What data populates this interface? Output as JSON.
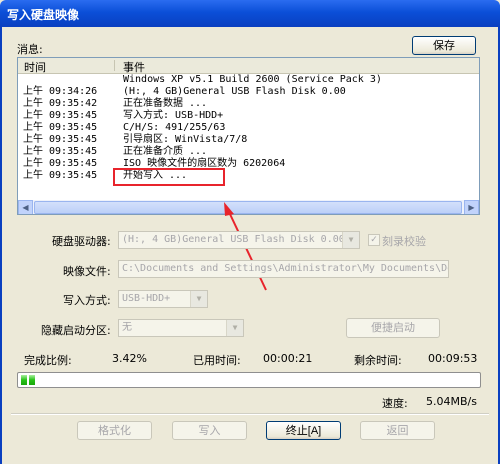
{
  "window": {
    "title": "写入硬盘映像"
  },
  "messages_label": "消息:",
  "save_button": "保存",
  "log": {
    "columns": [
      "时间",
      "事件"
    ],
    "rows": [
      {
        "time": "",
        "event": "Windows XP v5.1 Build 2600 (Service Pack 3)"
      },
      {
        "time": "上午 09:34:26",
        "event": "(H:, 4 GB)General USB Flash Disk  0.00"
      },
      {
        "time": "上午 09:35:42",
        "event": "正在准备数据 ..."
      },
      {
        "time": "上午 09:35:45",
        "event": "写入方式: USB-HDD+"
      },
      {
        "time": "上午 09:35:45",
        "event": "C/H/S: 491/255/63"
      },
      {
        "time": "上午 09:35:45",
        "event": "引导扇区: WinVista/7/8"
      },
      {
        "time": "上午 09:35:45",
        "event": "正在准备介质 ..."
      },
      {
        "time": "上午 09:35:45",
        "event": "ISO 映像文件的扇区数为 6202064"
      },
      {
        "time": "上午 09:35:45",
        "event": "开始写入 ..."
      }
    ]
  },
  "form": {
    "drive_label": "硬盘驱动器:",
    "drive_value": "(H:, 4 GB)General USB Flash Disk  0.00",
    "verify_label": "刻录校验",
    "image_label": "映像文件:",
    "image_value": "C:\\Documents and Settings\\Administrator\\My Documents\\Downlo",
    "write_mode_label": "写入方式:",
    "write_mode_value": "USB-HDD+",
    "hidden_partition_label": "隐藏启动分区:",
    "hidden_partition_value": "无",
    "quick_boot_button": "便捷启动"
  },
  "status": {
    "completion_label": "完成比例:",
    "completion_value": "3.42%",
    "elapsed_label": "已用时间:",
    "elapsed_value": "00:00:21",
    "remaining_label": "剩余时间:",
    "remaining_value": "00:09:53",
    "speed_label": "速度:",
    "speed_value": "5.04MB/s",
    "progress_fraction": 0.0342
  },
  "buttons": {
    "format": "格式化",
    "write": "写入",
    "stop": "终止[A]",
    "back": "返回"
  },
  "colors": {
    "highlight": "#e8242c",
    "progress": "#27c316",
    "titlebar": "#0b4fd8"
  }
}
